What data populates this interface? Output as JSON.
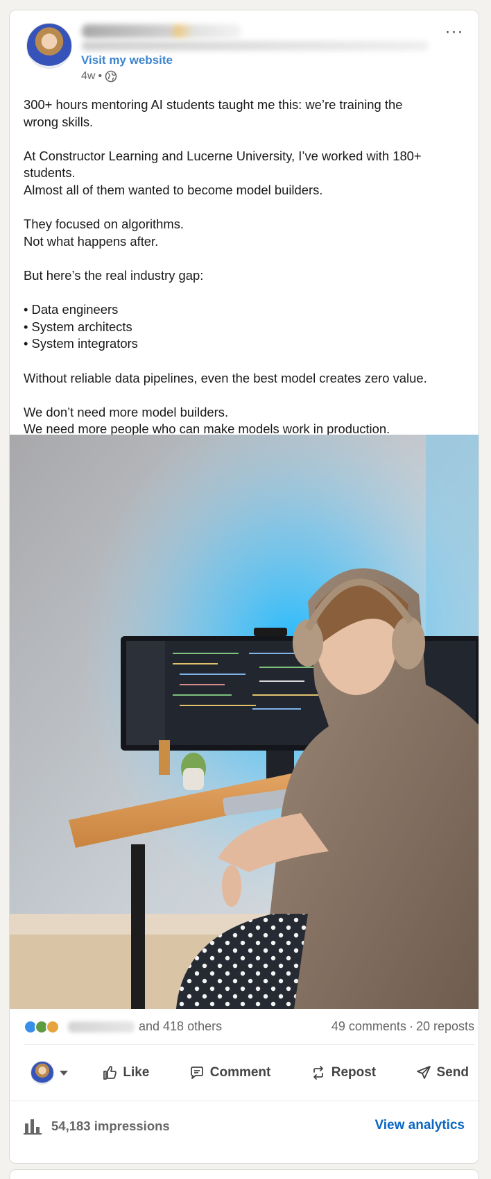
{
  "post": {
    "header": {
      "visit_link": "Visit my website",
      "age": "4w",
      "separator": "•",
      "visibility_icon": "globe-icon",
      "menu_icon": "more-horizontal-icon",
      "menu_label": "···"
    },
    "text_lines": [
      "300+ hours mentoring AI students taught me this: we’re training the",
      "wrong skills.",
      "",
      "At Constructor Learning and Lucerne University, I’ve worked with 180+",
      "students.",
      "Almost all of them wanted to become model builders.",
      "",
      "They focused on algorithms.",
      "Not what happens after.",
      "",
      "But here’s the real industry gap:",
      "",
      "• Data engineers",
      "• System architects",
      "• System integrators",
      "",
      "Without reliable data pipelines, even the best model creates zero value.",
      "",
      "We don’t need more model builders.",
      "We need more people who can make models work in production."
    ],
    "social": {
      "reaction_icons": [
        "celebrate-icon",
        "support-icon",
        "insightful-icon"
      ],
      "others": "and 418 others",
      "comments": "49 comments",
      "dot": "·",
      "reposts": "20 reposts"
    },
    "actions": {
      "like": "Like",
      "comment": "Comment",
      "repost": "Repost",
      "send": "Send"
    },
    "analytics": {
      "impressions": "54,183 impressions",
      "view_analytics": "View analytics"
    }
  },
  "colors": {
    "link_blue": "#0a66c2",
    "text": "#191919",
    "muted": "#666666",
    "background": "#f4f2ee"
  }
}
